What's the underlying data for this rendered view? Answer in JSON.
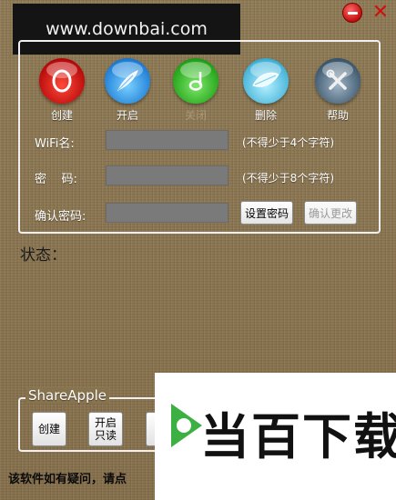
{
  "watermark": {
    "text": "www.downbai.com"
  },
  "window_controls": {
    "minimize_icon": "minimize-icon",
    "close_icon": "close-icon"
  },
  "toolbar": {
    "items": [
      {
        "label": "创建",
        "icon": "create-orb-icon",
        "color": "#d01a10",
        "disabled": false
      },
      {
        "label": "开启",
        "icon": "start-feather-icon",
        "color": "#1f7fd6",
        "disabled": false
      },
      {
        "label": "关闭",
        "icon": "close-note-icon",
        "color": "#23a31a",
        "disabled": true
      },
      {
        "label": "删除",
        "icon": "delete-leaf-icon",
        "color": "#44b3d8",
        "disabled": false
      },
      {
        "label": "帮助",
        "icon": "help-tools-icon",
        "color": "#3f5a70",
        "disabled": false
      }
    ]
  },
  "form": {
    "wifi_label": "WiFi名:",
    "wifi_hint": "(不得少于4个字符)",
    "password_label": "密    码:",
    "password_hint": "(不得少于8个字符)",
    "confirm_label": "确认密码:",
    "set_password_button": "设置密码",
    "confirm_change_button": "确认更改"
  },
  "status": {
    "label": "状态："
  },
  "share_apple": {
    "title": "ShareApple",
    "create_button": "创建",
    "readonly_button_line1": "开启",
    "readonly_button_line2": "只读"
  },
  "footer": {
    "text": "该软件如有疑问，请点"
  },
  "logo": {
    "text": "当百下载",
    "accent": "#3cb043"
  }
}
